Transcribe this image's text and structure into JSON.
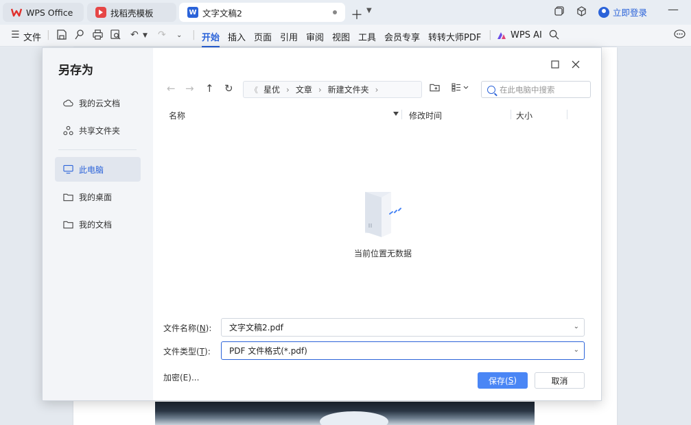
{
  "window": {
    "tabs": [
      {
        "label": "WPS Office",
        "icon": "wps-logo-icon"
      },
      {
        "label": "找稻壳模板",
        "icon": "docer-logo-icon"
      },
      {
        "label": "文字文稿2",
        "icon": "wps-writer-icon"
      }
    ],
    "login_label": "立即登录"
  },
  "ribbon": {
    "file_label": "文件",
    "tabs": [
      "开始",
      "插入",
      "页面",
      "引用",
      "审阅",
      "视图",
      "工具",
      "会员专享",
      "转转大师PDF"
    ],
    "active_tab": "开始",
    "ai_label": "WPS AI"
  },
  "dialog": {
    "title": "另存为",
    "sidebar": [
      {
        "label": "我的云文档",
        "icon": "cloud-icon"
      },
      {
        "label": "共享文件夹",
        "icon": "share-folder-icon"
      },
      {
        "label": "此电脑",
        "icon": "computer-icon",
        "active": true
      },
      {
        "label": "我的桌面",
        "icon": "folder-icon"
      },
      {
        "label": "我的文档",
        "icon": "folder-icon"
      }
    ],
    "breadcrumb": {
      "lead": "《",
      "items": [
        "星优",
        "文章",
        "新建文件夹"
      ]
    },
    "search_placeholder": "在此电脑中搜索",
    "columns": {
      "name": "名称",
      "modified": "修改时间",
      "size": "大小"
    },
    "empty_text": "当前位置无数据",
    "filename_label": "文件名称(N):",
    "filename_label_parts": {
      "pre": "文件名称(",
      "key": "N",
      "post": "):"
    },
    "filename_value": "文字文稿2.pdf",
    "filetype_label_parts": {
      "pre": "文件类型(",
      "key": "T",
      "post": "):"
    },
    "filetype_value": "PDF 文件格式(*.pdf)",
    "encrypt_label": "加密(E)...",
    "save_label_parts": {
      "pre": "保存(",
      "key": "S",
      "post": ")"
    },
    "cancel_label": "取消"
  }
}
